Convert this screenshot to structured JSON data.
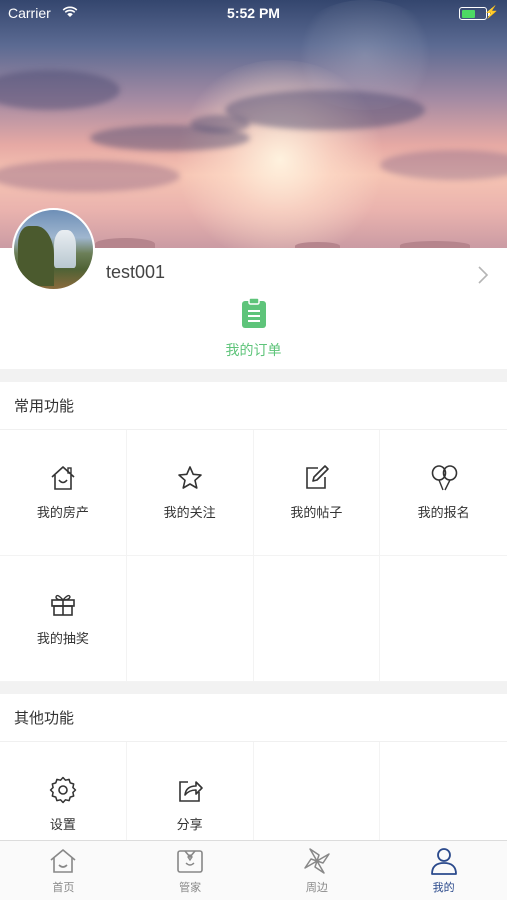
{
  "status_bar": {
    "carrier": "Carrier",
    "time": "5:52 PM",
    "battery_color": "#4cd964"
  },
  "profile": {
    "username": "test001",
    "order_label": "我的订单"
  },
  "common_section": {
    "title": "常用功能",
    "items": [
      {
        "label": "我的房产",
        "icon": "house-icon"
      },
      {
        "label": "我的关注",
        "icon": "star-icon"
      },
      {
        "label": "我的帖子",
        "icon": "edit-icon"
      },
      {
        "label": "我的报名",
        "icon": "balloons-icon"
      },
      {
        "label": "我的抽奖",
        "icon": "gift-icon"
      }
    ]
  },
  "other_section": {
    "title": "其他功能",
    "items": [
      {
        "label": "设置",
        "icon": "gear-icon"
      },
      {
        "label": "分享",
        "icon": "share-icon"
      }
    ]
  },
  "tab_bar": {
    "items": [
      {
        "label": "首页",
        "icon": "home-icon"
      },
      {
        "label": "管家",
        "icon": "butler-icon"
      },
      {
        "label": "周边",
        "icon": "pinwheel-icon"
      },
      {
        "label": "我的",
        "icon": "user-icon"
      }
    ],
    "active_index": 3,
    "active_color": "#2b4a8c"
  },
  "colors": {
    "accent_green": "#5ec47a"
  }
}
